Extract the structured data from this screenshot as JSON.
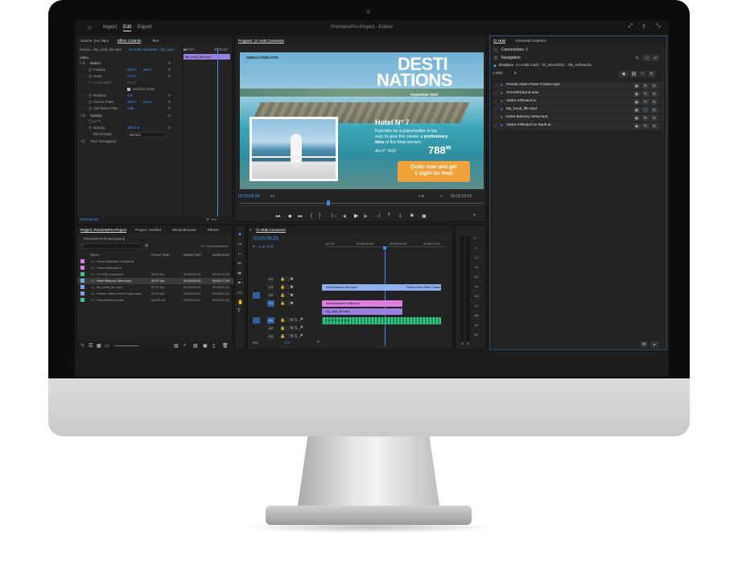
{
  "app": {
    "title": "PremierePro-Project - Edited",
    "tabs": [
      "Import",
      "Edit",
      "Export"
    ],
    "active_tab": "Edit"
  },
  "effect_controls": {
    "tabs": [
      "Source: (no clips)",
      "Effect Controls",
      "Text"
    ],
    "source_label": "Source - My_local_file.mp4",
    "sequence_label": "CI HUB Connector - My_loca...",
    "clip_label": "My_local_file.mp4",
    "time_start": "00:00",
    "time_end": "00:00:10",
    "section": "Video",
    "motion": "Motion",
    "properties": [
      {
        "name": "Position",
        "v1": "768.0",
        "v2": "529.7"
      },
      {
        "name": "Scale",
        "v1": "174.0",
        "v2": ""
      },
      {
        "name": "Scale Width",
        "v1": "100.0",
        "v2": ""
      },
      {
        "name": "Uniform Scale",
        "v1": "",
        "v2": ""
      },
      {
        "name": "Rotation",
        "v1": "0.0",
        "v2": ""
      },
      {
        "name": "Anchor Point",
        "v1": "960.0",
        "v2": "540.0"
      },
      {
        "name": "Anti-flicker Filter",
        "v1": "0.00",
        "v2": ""
      }
    ],
    "opacity_section": "Opacity",
    "opacity_label": "Opacity",
    "opacity_value": "100.0 %",
    "blend_label": "Blend Mode",
    "blend_value": "Normal",
    "time_remap": "Time Remapping",
    "timecode": "00;00;06;28"
  },
  "program": {
    "title": "Program: CI HUB Connector",
    "timecode_left": "00;00;06;28",
    "fit": "Fit",
    "quality": "Full",
    "timecode_right": "00;00;19;00"
  },
  "ad": {
    "url": "www.ci-hub.com",
    "headline1": "DESTI",
    "headline2": "NATIONS",
    "date": "September 2022",
    "hotel": "Hotel N° 7",
    "body1": "Function as a placeholder in lay",
    "body2": "outs to give the viewer a ",
    "body_bold": "preliminary",
    "body3": "idea",
    "body4": " of the final version.",
    "art": "Art-N° 3432",
    "price_main": "788",
    "price_sup": "99",
    "cta1": "Order now and get",
    "cta2": "1 night for free!"
  },
  "project": {
    "tabs": [
      "Project: PremierePro-Project",
      "Project: Untitled",
      "Media Browser",
      "Effects"
    ],
    "file": "PremierePro-Project.prproj",
    "selection": "1 of 7 items selected",
    "columns": [
      "Name",
      "Frame Rate",
      "Media Start",
      "Media End"
    ],
    "items": [
      {
        "name": "Video Artboard no Back.ai",
        "rate": "",
        "start": "",
        "end": "",
        "color": "#e07be0"
      },
      {
        "name": "Video Artboard.ai",
        "rate": "",
        "start": "",
        "end": "",
        "color": "#e07be0"
      },
      {
        "name": "CI HUB Connector",
        "rate": "29.97 fps",
        "start": "00;00;00;00",
        "end": "00;00;17;29",
        "color": "#3cc48a"
      },
      {
        "name": "Hotel Balcony View.mp4",
        "rate": "29.97 fps",
        "start": "00;00;00;00",
        "end": "00;00;17;29",
        "color": "#7aa6e8"
      },
      {
        "name": "My_local_file.mp4",
        "rate": "29.97 fps",
        "start": "00;00;00;00",
        "end": "00;00;41;13",
        "color": "#7aa6e8"
      },
      {
        "name": "Pexels Video Peter Fowler.mp4",
        "rate": "29.97 fps",
        "start": "00;00;00;00",
        "end": "00;00;41;13",
        "color": "#7aa6e8"
      },
      {
        "name": "SmoothSound.wav",
        "rate": "44100 Hz",
        "start": "00;00;00;07",
        "end": "00;00;41;13",
        "color": "#3cc48a"
      }
    ]
  },
  "timeline": {
    "title": "CI HUB Connector",
    "timecode": "00;00;06;28",
    "ruler": [
      "00;00",
      "00;00;04;00",
      "00;00;08;00",
      "00;00;12;00"
    ],
    "video_tracks": [
      "V4",
      "V3",
      "V2",
      "V1"
    ],
    "audio_tracks": [
      "A1",
      "A2",
      "A3"
    ],
    "mix_label": "Mix",
    "mix_value": "0.0",
    "clips": {
      "balcony": "Hotel Balcony View.mp4",
      "peter": "Pexels Video Peter Fowler",
      "artboard": "Video Artboard no Back.ai",
      "local": "My_local_file.mp4",
      "audio": "SmoothSound.wav"
    }
  },
  "meter": {
    "scale": [
      "0",
      "-6",
      "-12",
      "-18",
      "-24",
      "-30",
      "-36",
      "-42",
      "-48",
      "-54",
      "dB"
    ],
    "bottom": [
      "S",
      "S"
    ]
  },
  "cihub": {
    "tabs": [
      "CI HUB",
      "Essential Graphics"
    ],
    "connections": "Connections",
    "connections_count": "8",
    "navigation": "Navigation",
    "breadcrumb_source": "Dropbox",
    "breadcrumb_path": "CI HUB Card : 10_MAX2021 : 09_Artboards",
    "links_label": "Links:",
    "links_count": "6",
    "files": [
      {
        "name": "Pexels Video Peter Fowler.mp4"
      },
      {
        "name": "SmoothSound.wav"
      },
      {
        "name": "Video Artboard.ai"
      },
      {
        "name": "My_local_file.mp4"
      },
      {
        "name": "Hotel Balcony View.mp4"
      },
      {
        "name": "Video Artboard no Back.ai"
      }
    ]
  }
}
